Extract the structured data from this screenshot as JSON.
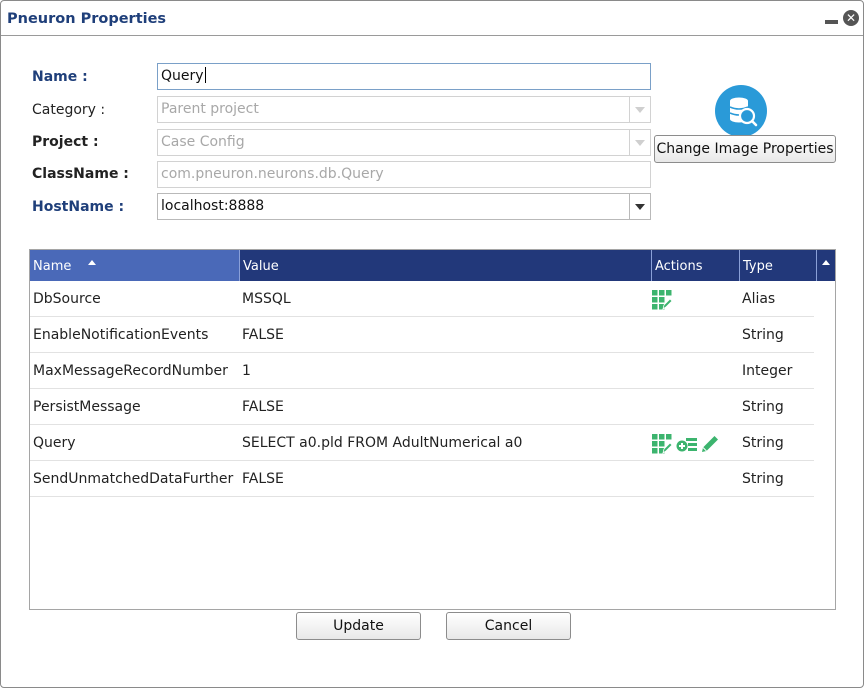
{
  "window": {
    "title": "Pneuron Properties"
  },
  "form": {
    "name_label": "Name :",
    "name_value": "Query",
    "category_label": "Category :",
    "category_value": "Parent project",
    "project_label": "Project :",
    "project_value": "Case Config",
    "classname_label": "ClassName :",
    "classname_value": "com.pneuron.neurons.db.Query",
    "hostname_label": "HostName :",
    "hostname_value": "localhost:8888",
    "change_image_label": "Change Image Properties"
  },
  "grid": {
    "columns": [
      "Name",
      "Value",
      "Actions",
      "Type"
    ],
    "sorted_column": "Name",
    "rows": [
      {
        "name": "DbSource",
        "value": "MSSQL",
        "actions": [
          "grid-edit-icon"
        ],
        "type": "Alias"
      },
      {
        "name": "EnableNotificationEvents",
        "value": "FALSE",
        "actions": [],
        "type": "String"
      },
      {
        "name": "MaxMessageRecordNumber",
        "value": "1",
        "actions": [],
        "type": "Integer"
      },
      {
        "name": "PersistMessage",
        "value": "FALSE",
        "actions": [],
        "type": "String"
      },
      {
        "name": "Query",
        "value": "SELECT a0.pld FROM AdultNumerical a0",
        "actions": [
          "grid-edit-icon",
          "add-list-icon",
          "pencil-icon"
        ],
        "type": "String"
      },
      {
        "name": "SendUnmatchedDataFurther",
        "value": "FALSE",
        "actions": [],
        "type": "String"
      }
    ]
  },
  "footer": {
    "update_label": "Update",
    "cancel_label": "Cancel"
  },
  "colors": {
    "title": "#1f3f7a",
    "header": "#22387a",
    "sorted_header": "#4a69b8",
    "action_icon": "#3cb46e",
    "db_icon": "#2a9ad8"
  }
}
